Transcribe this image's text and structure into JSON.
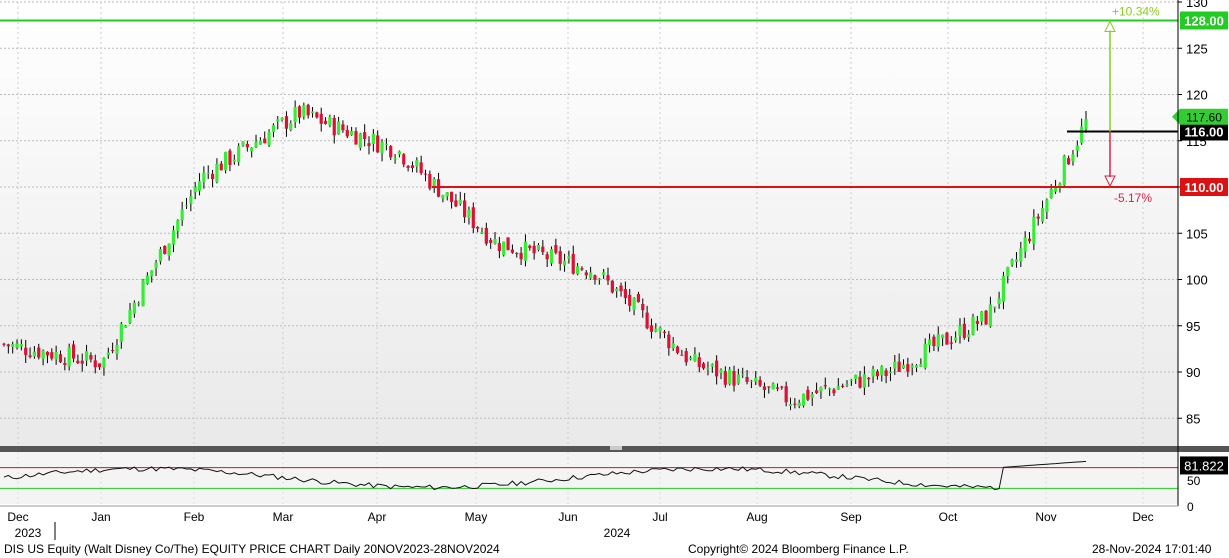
{
  "chart_data": [
    {
      "type": "candlestick",
      "title": "",
      "ylim": [
        82,
        130
      ],
      "y_ticks": [
        85,
        90,
        95,
        100,
        105,
        110,
        115,
        120,
        125,
        130
      ],
      "grid": true,
      "x_axis": {
        "month_labels": [
          "Dec",
          "Jan",
          "Feb",
          "Mar",
          "Apr",
          "May",
          "Jun",
          "Jul",
          "Aug",
          "Sep",
          "Oct",
          "Nov",
          "Dec"
        ],
        "year_labels": [
          "2023",
          "2024"
        ]
      },
      "approx_daily_close": [
        {
          "x": "Dec",
          "y": 93
        },
        {
          "x": "Jan",
          "y": 91
        },
        {
          "x": "Feb",
          "y": 111
        },
        {
          "x": "Mar",
          "y": 118
        },
        {
          "x": "Apr",
          "y": 114
        },
        {
          "x": "May",
          "y": 104
        },
        {
          "x": "Jun",
          "y": 101
        },
        {
          "x": "Jul",
          "y": 91
        },
        {
          "x": "Aug",
          "y": 87
        },
        {
          "x": "Sep",
          "y": 90
        },
        {
          "x": "Oct",
          "y": 96
        },
        {
          "x": "Nov",
          "y": 117
        }
      ],
      "horizontal_levels": [
        {
          "value": 128.0,
          "label": "128.00",
          "color": "#22cc22"
        },
        {
          "value": 116.0,
          "label": "116.00",
          "color": "#000000"
        },
        {
          "value": 110.0,
          "label": "110.00",
          "color": "#dd1111"
        }
      ],
      "last_price": {
        "value": 117.6,
        "label": "117.60",
        "color": "#33cc33"
      },
      "annotations": [
        {
          "text": "+10.34%",
          "color": "#88cc22"
        },
        {
          "text": "-5.17%",
          "color": "#dd2244"
        }
      ],
      "up_color": "#33ee33",
      "down_color": "#dd1133"
    },
    {
      "type": "line",
      "ylim": [
        0,
        100
      ],
      "y_ticks": [
        0,
        50
      ],
      "reference_lines": [
        {
          "value": 70,
          "color": "#dd1111"
        },
        {
          "value": 30,
          "color": "#22cc22"
        }
      ],
      "last_value": {
        "value": 81.822,
        "label": "81.822"
      }
    }
  ],
  "footer": {
    "left": "DIS US Equity (Walt Disney Co/The) EQUITY PRICE CHART  Daily 20NOV2023-28NOV2024",
    "center": "Copyright© 2024 Bloomberg Finance L.P.",
    "right": "28-Nov-2024 17:01:40"
  }
}
